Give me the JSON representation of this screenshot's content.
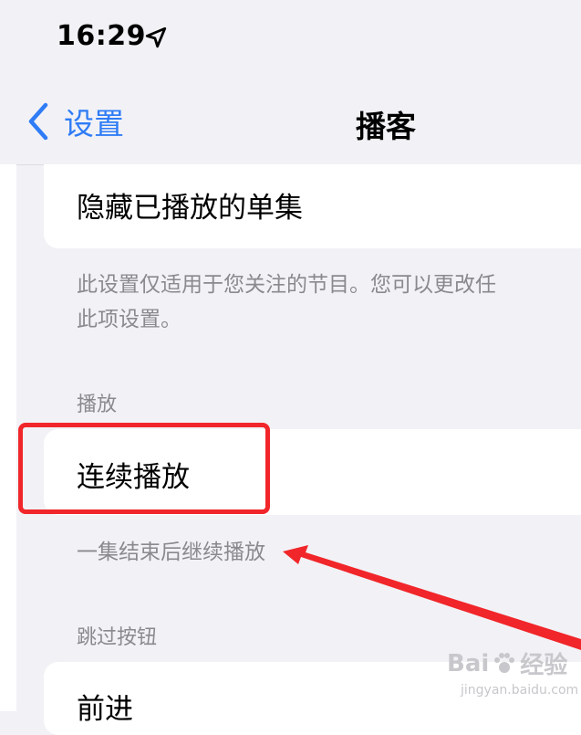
{
  "status_bar": {
    "time": "16:29"
  },
  "nav": {
    "back_label": "设置",
    "title": "播客"
  },
  "rows": {
    "hide_played": "隐藏已播放的单集",
    "hide_played_footer_line1": "此设置仅适用于您关注的节目。您可以更改任",
    "hide_played_footer_line2": "此项设置。",
    "playback_header": "播放",
    "continuous_play": "连续播放",
    "continuous_play_footer": "一集结束后继续播放",
    "skip_buttons_header": "跳过按钮",
    "forward": "前进"
  },
  "watermark": {
    "brand_left": "Bai",
    "brand_right": "经验",
    "sub": "jingyan.baidu.com"
  },
  "colors": {
    "accent": "#2f7cf6",
    "highlight": "#f1262a",
    "background": "#f2f2f6"
  }
}
